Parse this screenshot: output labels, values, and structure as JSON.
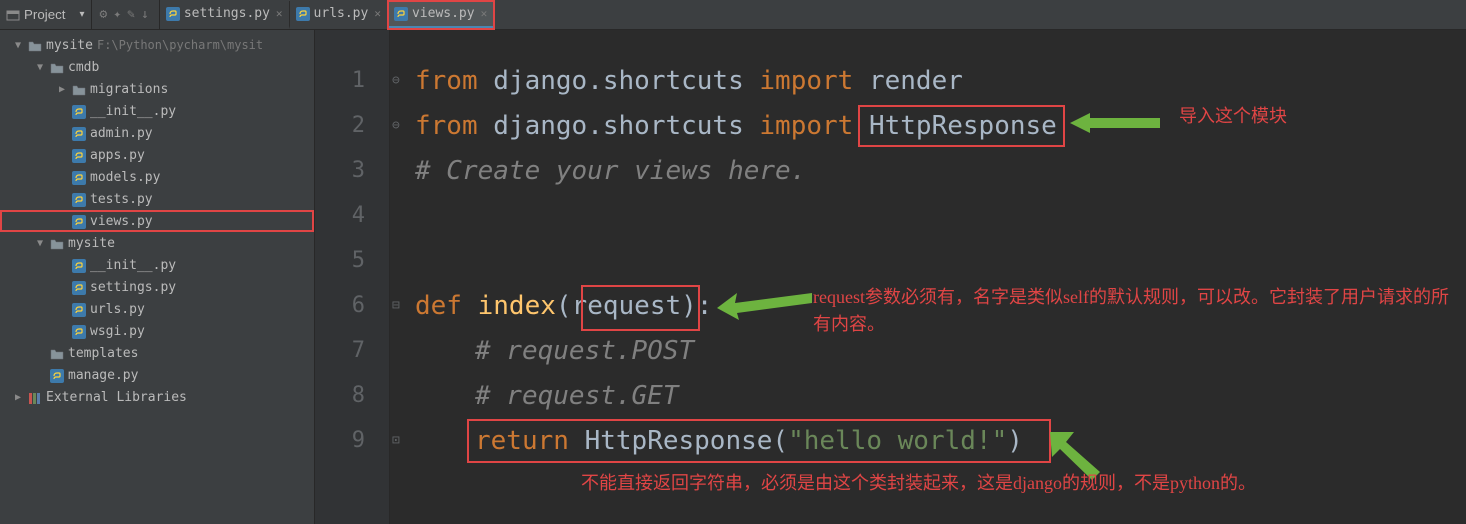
{
  "toolbar": {
    "project_label": "Project",
    "arrow": "▾",
    "icons": [
      "⚙",
      "✦",
      "✎",
      "↓"
    ]
  },
  "tabs": [
    {
      "name": "settings.py",
      "active": false
    },
    {
      "name": "urls.py",
      "active": false
    },
    {
      "name": "views.py",
      "active": true
    }
  ],
  "tree": [
    {
      "indent": 0,
      "arrow": "▼",
      "type": "folder-root",
      "label": "mysite",
      "path": "F:\\Python\\pycharm\\mysit",
      "icon": "folder"
    },
    {
      "indent": 1,
      "arrow": "▼",
      "type": "folder",
      "label": "cmdb",
      "icon": "folder"
    },
    {
      "indent": 2,
      "arrow": "▶",
      "type": "folder",
      "label": "migrations",
      "icon": "folder"
    },
    {
      "indent": 2,
      "arrow": "",
      "type": "py",
      "label": "__init__.py",
      "icon": "py"
    },
    {
      "indent": 2,
      "arrow": "",
      "type": "py",
      "label": "admin.py",
      "icon": "py"
    },
    {
      "indent": 2,
      "arrow": "",
      "type": "py",
      "label": "apps.py",
      "icon": "py"
    },
    {
      "indent": 2,
      "arrow": "",
      "type": "py",
      "label": "models.py",
      "icon": "py"
    },
    {
      "indent": 2,
      "arrow": "",
      "type": "py",
      "label": "tests.py",
      "icon": "py"
    },
    {
      "indent": 2,
      "arrow": "",
      "type": "py",
      "label": "views.py",
      "icon": "py",
      "hl": true
    },
    {
      "indent": 1,
      "arrow": "▼",
      "type": "folder",
      "label": "mysite",
      "icon": "folder"
    },
    {
      "indent": 2,
      "arrow": "",
      "type": "py",
      "label": "__init__.py",
      "icon": "py"
    },
    {
      "indent": 2,
      "arrow": "",
      "type": "py",
      "label": "settings.py",
      "icon": "py"
    },
    {
      "indent": 2,
      "arrow": "",
      "type": "py",
      "label": "urls.py",
      "icon": "py"
    },
    {
      "indent": 2,
      "arrow": "",
      "type": "py",
      "label": "wsgi.py",
      "icon": "py"
    },
    {
      "indent": 1,
      "arrow": "",
      "type": "folder",
      "label": "templates",
      "icon": "folder"
    },
    {
      "indent": 1,
      "arrow": "",
      "type": "py",
      "label": "manage.py",
      "icon": "py"
    },
    {
      "indent": 0,
      "arrow": "▶",
      "type": "lib",
      "label": "External Libraries",
      "icon": "lib"
    }
  ],
  "lines": [
    {
      "n": 1,
      "tokens": [
        [
          "kw",
          "from "
        ],
        [
          "par",
          "django.shortcuts "
        ],
        [
          "kw",
          "import "
        ],
        [
          "par",
          "render"
        ]
      ]
    },
    {
      "n": 2,
      "tokens": [
        [
          "kw",
          "from "
        ],
        [
          "par",
          "django.shortcuts "
        ],
        [
          "kw",
          "import "
        ],
        [
          "par",
          "HttpResponse"
        ]
      ]
    },
    {
      "n": 3,
      "tokens": [
        [
          "com",
          "# Create your views here."
        ]
      ]
    },
    {
      "n": 4,
      "tokens": []
    },
    {
      "n": 5,
      "tokens": []
    },
    {
      "n": 6,
      "tokens": [
        [
          "kw",
          "def "
        ],
        [
          "fn",
          "index"
        ],
        [
          "par",
          "(request):"
        ]
      ]
    },
    {
      "n": 7,
      "indent": 1,
      "tokens": [
        [
          "com",
          "# request.POST"
        ]
      ]
    },
    {
      "n": 8,
      "indent": 1,
      "tokens": [
        [
          "com",
          "# request.GET"
        ]
      ]
    },
    {
      "n": 9,
      "indent": 1,
      "tokens": [
        [
          "kw",
          "return "
        ],
        [
          "par",
          "HttpResponse("
        ],
        [
          "str",
          "\"hello world!\""
        ],
        [
          "par",
          ")"
        ]
      ]
    }
  ],
  "annotations": {
    "a1": "导入这个模块",
    "a2": "request参数必须有，名字是类似self的默认规则，可以改。它封装了用户请求的所有内容。",
    "a3": "不能直接返回字符串，必须是由这个类封装起来，这是django的规则，不是python的。"
  }
}
